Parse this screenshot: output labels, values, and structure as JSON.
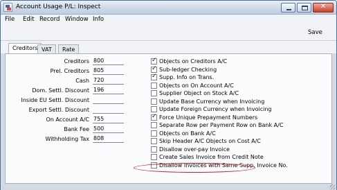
{
  "window": {
    "title": "Account Usage P/L: Inspect",
    "controls": {
      "minimize_icon": "minimize-icon",
      "maximize_icon": "maximize-icon",
      "close_glyph": "✕"
    }
  },
  "menu": [
    "File",
    "Edit",
    "Record",
    "Window",
    "Info"
  ],
  "toolbar": {
    "save_label": "Save"
  },
  "tabs": [
    {
      "label": "Creditors",
      "active": true
    },
    {
      "label": "VAT",
      "active": false
    },
    {
      "label": "Rate",
      "active": false
    }
  ],
  "fields": [
    {
      "label": "Creditors",
      "value": "800"
    },
    {
      "label": "Prel. Creditors",
      "value": "805"
    },
    {
      "label": "Cash",
      "value": "720"
    },
    {
      "label": "Dom. Settl. Discount",
      "value": "196"
    },
    {
      "label": "Inside EU Settl. Discount",
      "value": ""
    },
    {
      "label": "Export Settl. Discount",
      "value": ""
    },
    {
      "label": "On Account A/C",
      "value": "755"
    },
    {
      "label": "Bank Fee",
      "value": "500"
    },
    {
      "label": "Withholding Tax",
      "value": "808"
    }
  ],
  "options": [
    {
      "label": "Objects on Creditors A/C",
      "checked": true
    },
    {
      "label": "Sub-ledger Checking",
      "checked": true
    },
    {
      "label": "Supp. Info on Trans.",
      "checked": true
    },
    {
      "label": "Objects on On Account A/C",
      "checked": false
    },
    {
      "label": "Supplier Object on Stock A/C",
      "checked": false
    },
    {
      "label": "Update Base Currency when Invoicing",
      "checked": false
    },
    {
      "label": "Update Foreign Currency when Invoicing",
      "checked": false
    },
    {
      "label": "Force Unique Prepayment Numbers",
      "checked": true
    },
    {
      "label": "Separate Row per Payment Row on Bank A/C",
      "checked": false
    },
    {
      "label": "Objects on Bank A/C",
      "checked": false
    },
    {
      "label": "Skip Header A/C Objects on Cost A/C",
      "checked": false
    },
    {
      "label": "Disallow over-pay Invoice",
      "checked": false
    },
    {
      "label": "Create Sales Invoice from Credit Note",
      "checked": false
    },
    {
      "label": "Disallow Invoices with Same Supp. Invoice No.",
      "checked": false
    }
  ],
  "check_glyph": "✓",
  "colors": {
    "highlight_oval": "#e0181c",
    "title_bar": "#cdd9e7"
  }
}
